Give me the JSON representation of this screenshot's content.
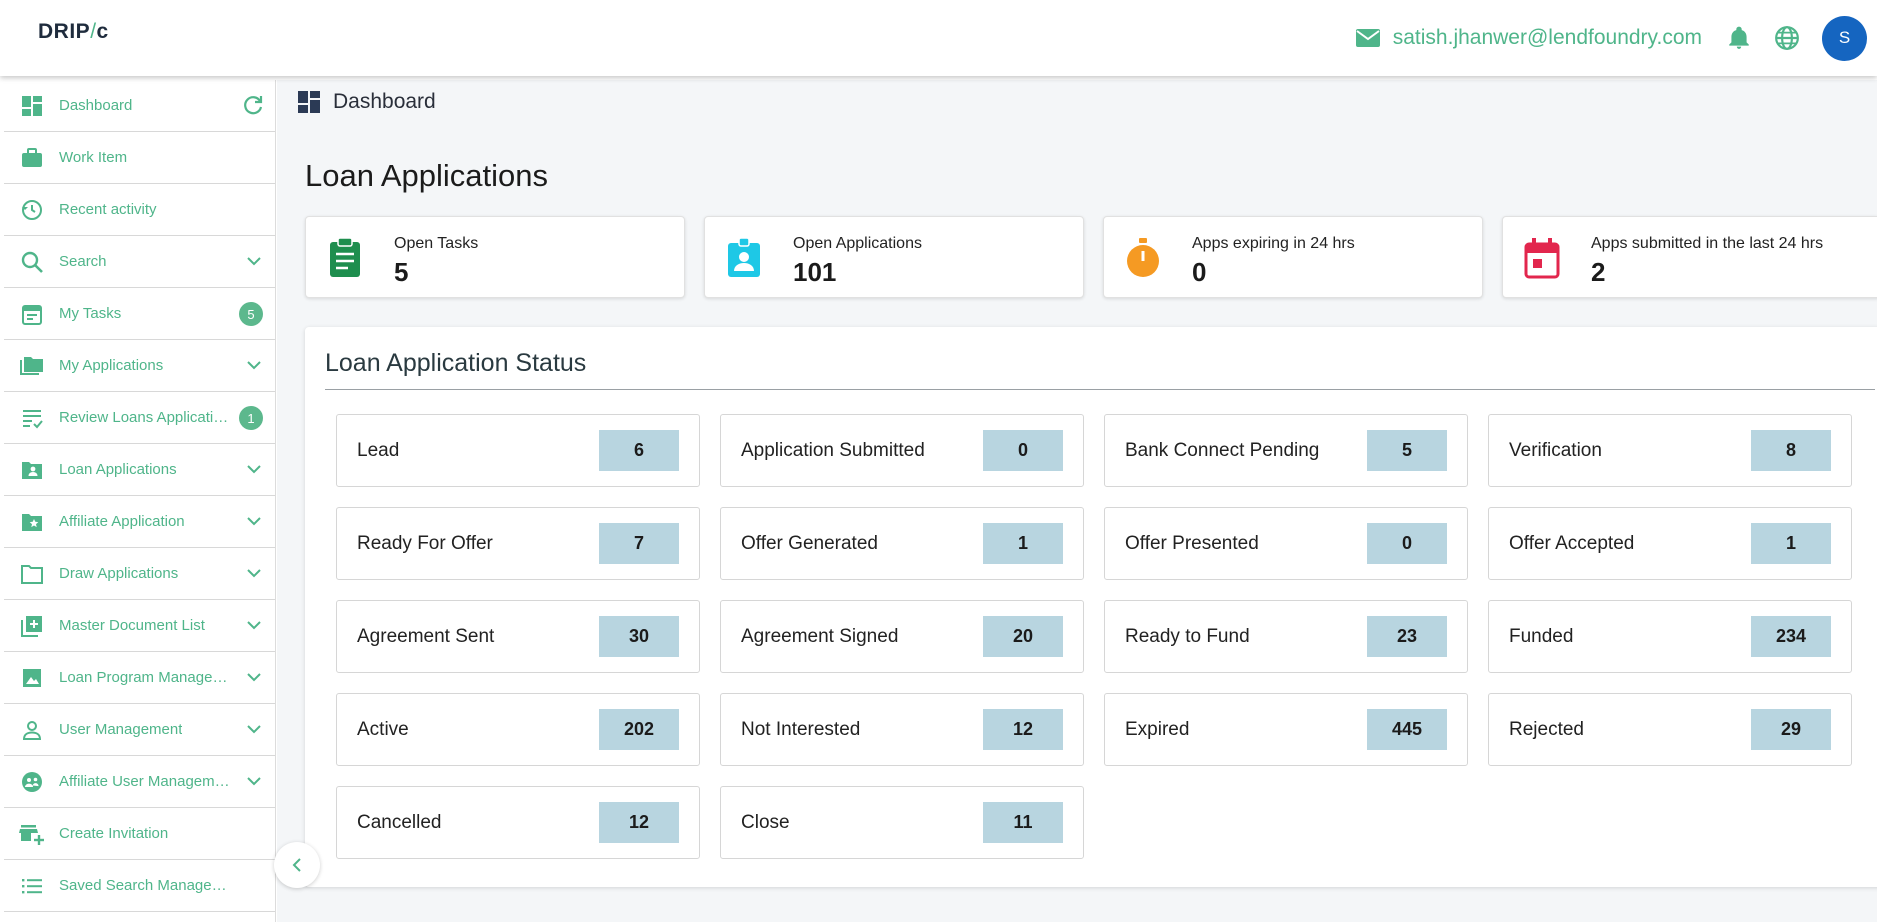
{
  "header": {
    "logo_main": "DRIP",
    "logo_slash": "/",
    "logo_tail": "c",
    "email": "satish.jhanwer@lendfoundry.com",
    "avatar_initial": "S",
    "mail_icon": "mail-icon",
    "bell_icon": "bell-icon",
    "globe_icon": "globe-icon"
  },
  "sidebar": {
    "items": [
      {
        "label": "Dashboard",
        "icon": "dashboard-icon",
        "trailing": "refresh"
      },
      {
        "label": "Work Item",
        "icon": "briefcase-icon",
        "trailing": ""
      },
      {
        "label": "Recent activity",
        "icon": "history-icon",
        "trailing": ""
      },
      {
        "label": "Search",
        "icon": "search-icon",
        "trailing": "chevron"
      },
      {
        "label": "My Tasks",
        "icon": "calendar-icon",
        "trailing": "badge",
        "badge": "5"
      },
      {
        "label": "My Applications",
        "icon": "folders-icon",
        "trailing": "chevron"
      },
      {
        "label": "Review Loans Applications",
        "icon": "checklist-icon",
        "trailing": "badge",
        "badge": "1"
      },
      {
        "label": "Loan Applications",
        "icon": "folder-user-icon",
        "trailing": "chevron"
      },
      {
        "label": "Affiliate Application",
        "icon": "folder-star-icon",
        "trailing": "chevron"
      },
      {
        "label": "Draw Applications",
        "icon": "folder-outline-icon",
        "trailing": "chevron"
      },
      {
        "label": "Master Document List",
        "icon": "add-document-icon",
        "trailing": "chevron"
      },
      {
        "label": "Loan Program Management",
        "icon": "image-icon",
        "trailing": "chevron"
      },
      {
        "label": "User Management",
        "icon": "person-icon",
        "trailing": "chevron"
      },
      {
        "label": "Affiliate User Management",
        "icon": "group-icon",
        "trailing": "chevron"
      },
      {
        "label": "Create Invitation",
        "icon": "store-add-icon",
        "trailing": ""
      },
      {
        "label": "Saved Search Management",
        "icon": "list-icon",
        "trailing": ""
      }
    ]
  },
  "breadcrumb": {
    "label": "Dashboard"
  },
  "page": {
    "title": "Loan Applications"
  },
  "stats": [
    {
      "label": "Open Tasks",
      "value": "5",
      "icon": "clipboard-icon",
      "color": "#1e8e4e"
    },
    {
      "label": "Open Applications",
      "value": "101",
      "icon": "id-badge-icon",
      "color": "#1ec8e6"
    },
    {
      "label": "Apps expiring in 24 hrs",
      "value": "0",
      "icon": "stopwatch-icon",
      "color": "#f59a23"
    },
    {
      "label": "Apps submitted in the last 24 hrs",
      "value": "2",
      "icon": "calendar-event-icon",
      "color": "#e2264d"
    }
  ],
  "status": {
    "title": "Loan Application Status",
    "tiles": [
      {
        "label": "Lead",
        "value": "6"
      },
      {
        "label": "Application Submitted",
        "value": "0"
      },
      {
        "label": "Bank Connect Pending",
        "value": "5"
      },
      {
        "label": "Verification",
        "value": "8"
      },
      {
        "label": "Ready For Offer",
        "value": "7"
      },
      {
        "label": "Offer Generated",
        "value": "1"
      },
      {
        "label": "Offer Presented",
        "value": "0"
      },
      {
        "label": "Offer Accepted",
        "value": "1"
      },
      {
        "label": "Agreement Sent",
        "value": "30"
      },
      {
        "label": "Agreement Signed",
        "value": "20"
      },
      {
        "label": "Ready to Fund",
        "value": "23"
      },
      {
        "label": "Funded",
        "value": "234"
      },
      {
        "label": "Active",
        "value": "202"
      },
      {
        "label": "Not Interested",
        "value": "12"
      },
      {
        "label": "Expired",
        "value": "445"
      },
      {
        "label": "Rejected",
        "value": "29"
      },
      {
        "label": "Cancelled",
        "value": "12"
      },
      {
        "label": "Close",
        "value": "11"
      }
    ]
  },
  "colors": {
    "accent": "#4fb58a",
    "tile_value_bg": "#b8d5e0",
    "avatar_bg": "#1565c0"
  }
}
